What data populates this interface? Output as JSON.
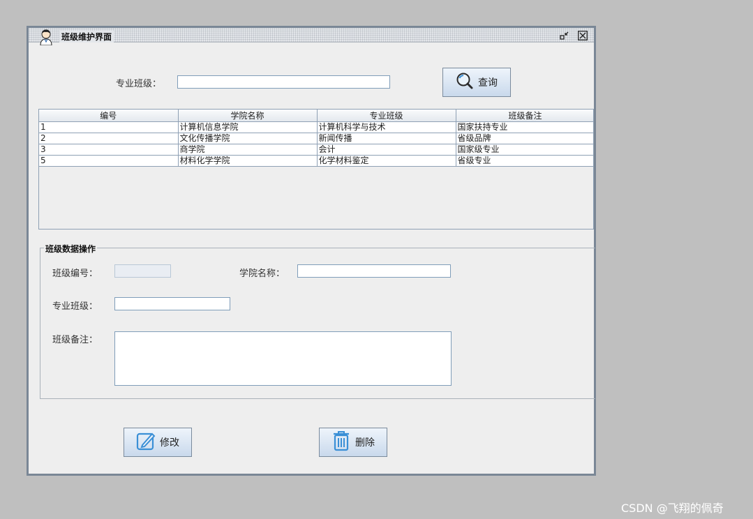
{
  "window": {
    "title": "班级维护界面",
    "icon": "user-avatar-icon"
  },
  "search": {
    "label": "专业班级：",
    "value": "",
    "button_label": "查询",
    "button_icon": "magnifier-icon"
  },
  "table": {
    "columns": [
      "编号",
      "学院名称",
      "专业班级",
      "班级备注"
    ],
    "rows": [
      [
        "1",
        "计算机信息学院",
        "计算机科学与技术",
        "国家扶持专业"
      ],
      [
        "2",
        "文化传播学院",
        "新闻传播",
        "省级品牌"
      ],
      [
        "3",
        "商学院",
        "会计",
        "国家级专业"
      ],
      [
        "5",
        "材料化学学院",
        "化学材料鉴定",
        "省级专业"
      ]
    ]
  },
  "form": {
    "group_title": "班级数据操作",
    "id_label": "班级编号：",
    "id_value": "",
    "college_label": "学院名称：",
    "college_value": "",
    "major_label": "专业班级：",
    "major_value": "",
    "remark_label": "班级备注：",
    "remark_value": ""
  },
  "actions": {
    "modify_label": "修改",
    "delete_label": "删除"
  },
  "watermark": "CSDN @飞翔的佩奇",
  "colors": {
    "accent": "#3a8fd6",
    "frame": "#7a8796",
    "desktop": "#bfbfbf"
  }
}
